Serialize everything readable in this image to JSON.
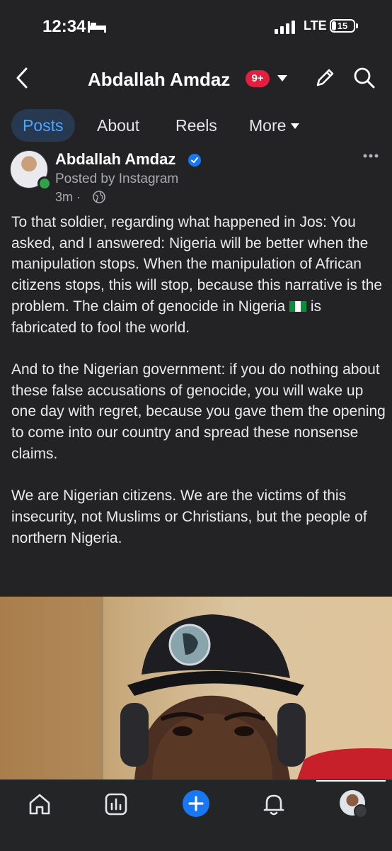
{
  "status_bar": {
    "time": "12:34",
    "network": "LTE",
    "battery": "15"
  },
  "header": {
    "title": "Abdallah Amdaz",
    "badge": "9+"
  },
  "tabs": [
    {
      "label": "Posts",
      "active": true
    },
    {
      "label": "About"
    },
    {
      "label": "Reels"
    },
    {
      "label": "More"
    }
  ],
  "post": {
    "author": "Abdallah Amdaz",
    "posted_by": "Posted by Instagram",
    "time": "3m",
    "dot": "·",
    "paragraph1a": "To that soldier, regarding what happened in Jos: You asked, and I answered: Nigeria will be better when the manipulation stops. When the manipulation of African citizens stops, this will stop, because this narrative is the problem. The claim of genocide in Nigeria",
    "paragraph1b": "is fabricated to fool the world.",
    "paragraph2": "And to the Nigerian government: if you do nothing about these false accusations of genocide, you will wake up one day with regret, because you gave them the opening to come into our country and spread these nonsense claims.",
    "paragraph3": "We are Nigerian citizens. We are the victims of this insecurity, not Muslims or Christians, but the people of northern Nigeria."
  },
  "colors": {
    "accent": "#4ea5ff",
    "background": "#232326",
    "notification": "#e41e3f",
    "plus": "#1877f2"
  },
  "icons": [
    "back-arrow-icon",
    "chevron-down-icon",
    "pencil-icon",
    "search-icon",
    "verified-icon",
    "globe-icon",
    "more-dots-icon",
    "home-icon",
    "dashboard-icon",
    "plus-icon",
    "bell-icon"
  ]
}
